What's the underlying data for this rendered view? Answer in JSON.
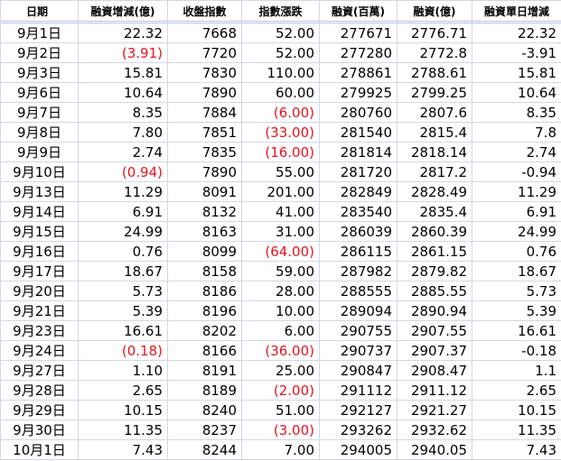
{
  "headers": [
    "日期",
    "融資增減(億)",
    "收盤指數",
    "指數漲跌",
    "融資(百萬)",
    "融資(億)",
    "融資單日增減"
  ],
  "negative_color": "#e8121b",
  "rows": [
    {
      "date": "9月1日",
      "margin_change": "22.32",
      "close": "7668",
      "index_change": "52.00",
      "margin_mil": "277671",
      "margin_100m": "2776.71",
      "daily_change": "22.32"
    },
    {
      "date": "9月2日",
      "margin_change": "(3.91)",
      "close": "7720",
      "index_change": "52.00",
      "margin_mil": "277280",
      "margin_100m": "2772.8",
      "daily_change": "-3.91"
    },
    {
      "date": "9月3日",
      "margin_change": "15.81",
      "close": "7830",
      "index_change": "110.00",
      "margin_mil": "278861",
      "margin_100m": "2788.61",
      "daily_change": "15.81"
    },
    {
      "date": "9月6日",
      "margin_change": "10.64",
      "close": "7890",
      "index_change": "60.00",
      "margin_mil": "279925",
      "margin_100m": "2799.25",
      "daily_change": "10.64"
    },
    {
      "date": "9月7日",
      "margin_change": "8.35",
      "close": "7884",
      "index_change": "(6.00)",
      "margin_mil": "280760",
      "margin_100m": "2807.6",
      "daily_change": "8.35"
    },
    {
      "date": "9月8日",
      "margin_change": "7.80",
      "close": "7851",
      "index_change": "(33.00)",
      "margin_mil": "281540",
      "margin_100m": "2815.4",
      "daily_change": "7.8"
    },
    {
      "date": "9月9日",
      "margin_change": "2.74",
      "close": "7835",
      "index_change": "(16.00)",
      "margin_mil": "281814",
      "margin_100m": "2818.14",
      "daily_change": "2.74"
    },
    {
      "date": "9月10日",
      "margin_change": "(0.94)",
      "close": "7890",
      "index_change": "55.00",
      "margin_mil": "281720",
      "margin_100m": "2817.2",
      "daily_change": "-0.94"
    },
    {
      "date": "9月13日",
      "margin_change": "11.29",
      "close": "8091",
      "index_change": "201.00",
      "margin_mil": "282849",
      "margin_100m": "2828.49",
      "daily_change": "11.29"
    },
    {
      "date": "9月14日",
      "margin_change": "6.91",
      "close": "8132",
      "index_change": "41.00",
      "margin_mil": "283540",
      "margin_100m": "2835.4",
      "daily_change": "6.91"
    },
    {
      "date": "9月15日",
      "margin_change": "24.99",
      "close": "8163",
      "index_change": "31.00",
      "margin_mil": "286039",
      "margin_100m": "2860.39",
      "daily_change": "24.99"
    },
    {
      "date": "9月16日",
      "margin_change": "0.76",
      "close": "8099",
      "index_change": "(64.00)",
      "margin_mil": "286115",
      "margin_100m": "2861.15",
      "daily_change": "0.76"
    },
    {
      "date": "9月17日",
      "margin_change": "18.67",
      "close": "8158",
      "index_change": "59.00",
      "margin_mil": "287982",
      "margin_100m": "2879.82",
      "daily_change": "18.67"
    },
    {
      "date": "9月20日",
      "margin_change": "5.73",
      "close": "8186",
      "index_change": "28.00",
      "margin_mil": "288555",
      "margin_100m": "2885.55",
      "daily_change": "5.73"
    },
    {
      "date": "9月21日",
      "margin_change": "5.39",
      "close": "8196",
      "index_change": "10.00",
      "margin_mil": "289094",
      "margin_100m": "2890.94",
      "daily_change": "5.39"
    },
    {
      "date": "9月23日",
      "margin_change": "16.61",
      "close": "8202",
      "index_change": "6.00",
      "margin_mil": "290755",
      "margin_100m": "2907.55",
      "daily_change": "16.61"
    },
    {
      "date": "9月24日",
      "margin_change": "(0.18)",
      "close": "8166",
      "index_change": "(36.00)",
      "margin_mil": "290737",
      "margin_100m": "2907.37",
      "daily_change": "-0.18"
    },
    {
      "date": "9月27日",
      "margin_change": "1.10",
      "close": "8191",
      "index_change": "25.00",
      "margin_mil": "290847",
      "margin_100m": "2908.47",
      "daily_change": "1.1"
    },
    {
      "date": "9月28日",
      "margin_change": "2.65",
      "close": "8189",
      "index_change": "(2.00)",
      "margin_mil": "291112",
      "margin_100m": "2911.12",
      "daily_change": "2.65"
    },
    {
      "date": "9月29日",
      "margin_change": "10.15",
      "close": "8240",
      "index_change": "51.00",
      "margin_mil": "292127",
      "margin_100m": "2921.27",
      "daily_change": "10.15"
    },
    {
      "date": "9月30日",
      "margin_change": "11.35",
      "close": "8237",
      "index_change": "(3.00)",
      "margin_mil": "293262",
      "margin_100m": "2932.62",
      "daily_change": "11.35"
    },
    {
      "date": "10月1日",
      "margin_change": "7.43",
      "close": "8244",
      "index_change": "7.00",
      "margin_mil": "294005",
      "margin_100m": "2940.05",
      "daily_change": "7.43"
    }
  ]
}
